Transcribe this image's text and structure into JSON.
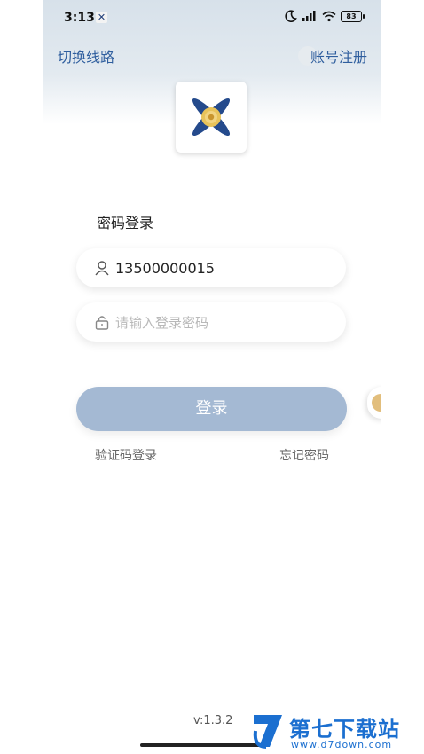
{
  "status_bar": {
    "time": "3:13",
    "app_glyph": "✕",
    "battery": "83"
  },
  "header": {
    "switch_line": "切换线路",
    "register": "账号注册"
  },
  "login": {
    "heading": "密码登录",
    "phone_value": "13500000015",
    "password_placeholder": "请输入登录密码",
    "submit_label": "登录",
    "code_login": "验证码登录",
    "forgot_password": "忘记密码"
  },
  "footer": {
    "version": "v:1.3.2"
  },
  "watermark": {
    "title": "第七下载站",
    "url": "www.d7down.com"
  },
  "colors": {
    "accent": "#2f5e9e",
    "button": "#a4b9d3",
    "watermark": "#1b6fd0"
  },
  "icons": [
    "moon-icon",
    "signal-icon",
    "wifi-icon",
    "battery-icon",
    "user-icon",
    "lock-icon",
    "logo-icon"
  ]
}
